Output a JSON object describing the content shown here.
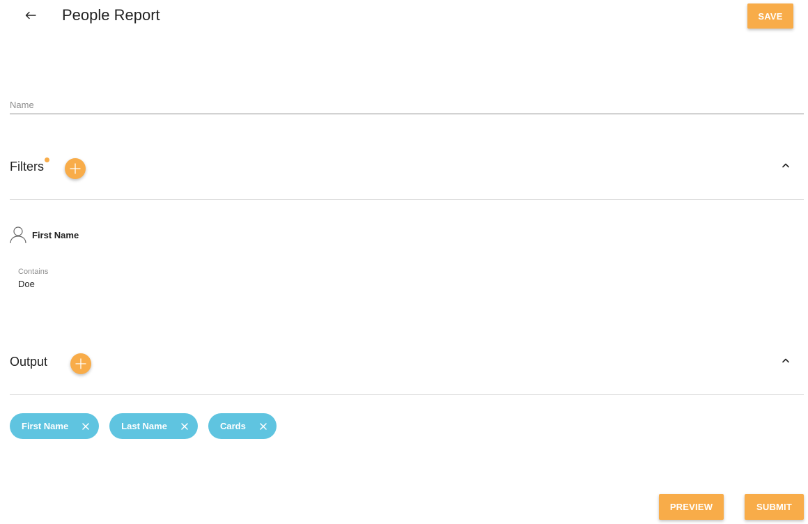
{
  "header": {
    "back_icon": "arrow-left-icon",
    "title": "People Report",
    "save_label": "SAVE"
  },
  "name_field": {
    "placeholder": "Name",
    "value": ""
  },
  "filters": {
    "title": "Filters",
    "add_icon": "plus-icon",
    "collapse_icon": "chevron-up-icon",
    "items": [
      {
        "icon": "person-icon",
        "field": "First Name",
        "condition_label": "Contains",
        "condition_value": "Doe"
      }
    ]
  },
  "output": {
    "title": "Output",
    "add_icon": "plus-icon",
    "collapse_icon": "chevron-up-icon",
    "chips": [
      {
        "label": "First Name"
      },
      {
        "label": "Last Name"
      },
      {
        "label": "Cards"
      }
    ]
  },
  "footer": {
    "preview_label": "PREVIEW",
    "submit_label": "SUBMIT"
  },
  "colors": {
    "accent": "#f8ac49",
    "chip": "#5fc4e0",
    "divider": "#d9d9d9"
  }
}
